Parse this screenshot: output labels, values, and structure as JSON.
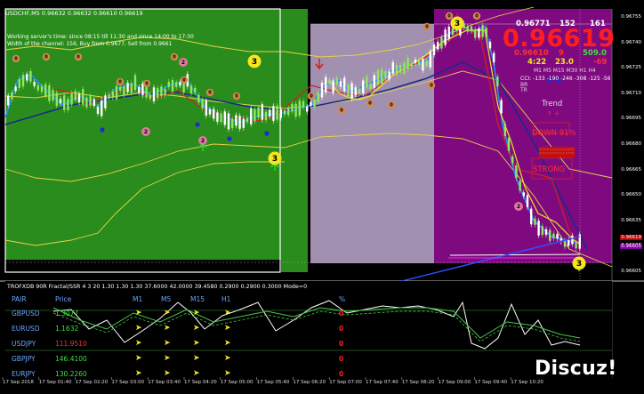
{
  "window": {
    "title": "USDCHF,M5  0.96632 0.96632 0.96610 0.96619",
    "server_time": "Working server's time: since 08:15 till 11:30 and since 14:00 to 17:30",
    "channel_width": "Width of the channel: 156, Buy from 0.9677, Sell from 0.9661"
  },
  "price_axis": {
    "labels": [
      "0.96755",
      "0.96740",
      "0.96725",
      "0.96710",
      "0.96695",
      "0.96680",
      "0.96665",
      "0.96650",
      "0.96635",
      "0.96620",
      "0.96605"
    ],
    "current": "0.96619",
    "line_label": "0.96605"
  },
  "time_axis": {
    "labels": [
      "17 Sep 2018",
      "17 Sep 01:40",
      "17 Sep 02:20",
      "17 Sep 03:00",
      "17 Sep 03:40",
      "17 Sep 04:20",
      "17 Sep 05:00",
      "17 Sep 05:40",
      "17 Sep 06:20",
      "17 Sep 07:00",
      "17 Sep 07:40",
      "17 Sep 08:20",
      "17 Sep 09:00",
      "17 Sep 09:40",
      "17 Sep 10:20"
    ]
  },
  "price_panel": {
    "row1": [
      "0.96771",
      "152",
      "161"
    ],
    "big_price": "0.96619",
    "row2": [
      "0.96610",
      "9",
      "509.0"
    ],
    "row3": [
      "4:22",
      "23.0",
      "-69"
    ],
    "timeframes": "M1  M5  M15  M30  H1   H4",
    "cci": "CCI: -133 -190 -246 -308 -125 -56",
    "br": "BR",
    "tr": "TR",
    "trend_label": "Trend",
    "trend_symbols": "↑  +",
    "down_label": "DOWN 91%",
    "strong_label": "STRONG"
  },
  "markers": {
    "yellow_three": "3",
    "orange_zero": "0",
    "pink_two": "2"
  },
  "sub_window": {
    "title": "TROFXDB 90R  Fractal/SSR  4  3  20  1.30 1.30 1.30 37.6000 42.0000 39.4580 0.2900 0.2900 0.3000  Mode=0"
  },
  "currency_table": {
    "headers": [
      "PAIR",
      "Price",
      "M1",
      "M5",
      "M15",
      "H1",
      "%"
    ],
    "rows": [
      {
        "pair": "GBPUSD",
        "price": "1.3077",
        "pct": "0",
        "price_color": "#3ee03e"
      },
      {
        "pair": "EURUSD",
        "price": "1.1632",
        "pct": "0",
        "price_color": "#3ee03e"
      },
      {
        "pair": "USDJPY",
        "price": "111.9510",
        "pct": "0",
        "price_color": "#ff2a2a"
      },
      {
        "pair": "GBPJPY",
        "price": "146.4100",
        "pct": "0",
        "price_color": "#3ee03e"
      },
      {
        "pair": "EURJPY",
        "price": "130.2260",
        "pct": "0",
        "price_color": "#3ee03e"
      }
    ],
    "arrow_glyph": "➤"
  },
  "watermark": "Discuz!",
  "colors": {
    "zone_green": "#2a8c1c",
    "zone_lavender": "#a190b0",
    "zone_purple": "#7f0a7f",
    "bb_line": "#e6d34a",
    "ma_fast": "#1e90ff",
    "ma_slow": "#1a2a88",
    "alert_red": "#ff1e1e"
  }
}
